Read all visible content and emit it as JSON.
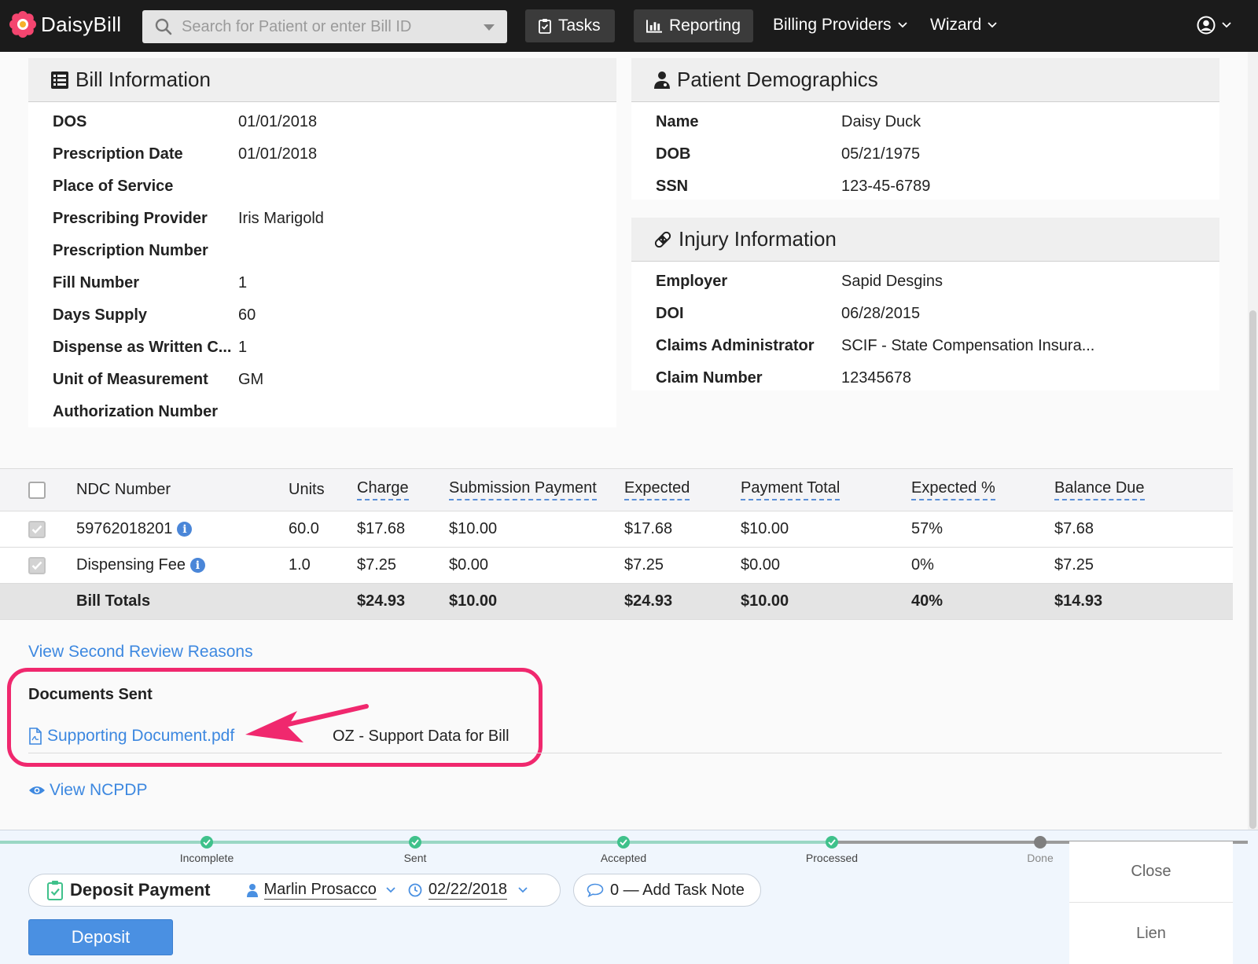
{
  "nav": {
    "brand": "DaisyBill",
    "search_placeholder": "Search for Patient or enter Bill ID",
    "tasks_label": "Tasks",
    "reporting_label": "Reporting",
    "billing_providers_label": "Billing Providers",
    "wizard_label": "Wizard"
  },
  "bill_info": {
    "title": "Bill Information",
    "rows": [
      {
        "label": "DOS",
        "value": "01/01/2018"
      },
      {
        "label": "Prescription Date",
        "value": "01/01/2018"
      },
      {
        "label": "Place of Service",
        "value": ""
      },
      {
        "label": "Prescribing Provider",
        "value": "Iris Marigold"
      },
      {
        "label": "Prescription Number",
        "value": ""
      },
      {
        "label": "Fill Number",
        "value": "1"
      },
      {
        "label": "Days Supply",
        "value": "60"
      },
      {
        "label": "Dispense as Written C...",
        "value": "1"
      },
      {
        "label": "Unit of Measurement",
        "value": "GM"
      },
      {
        "label": "Authorization Number",
        "value": ""
      }
    ]
  },
  "patient": {
    "title": "Patient Demographics",
    "rows": [
      {
        "label": "Name",
        "value": "Daisy Duck"
      },
      {
        "label": "DOB",
        "value": "05/21/1975"
      },
      {
        "label": "SSN",
        "value": "123-45-6789"
      }
    ]
  },
  "injury": {
    "title": "Injury Information",
    "rows": [
      {
        "label": "Employer",
        "value": "Sapid Desgins"
      },
      {
        "label": "DOI",
        "value": "06/28/2015"
      },
      {
        "label": "Claims Administrator",
        "value": "SCIF - State Compensation Insura..."
      },
      {
        "label": "Claim Number",
        "value": "12345678"
      }
    ]
  },
  "table": {
    "headers": {
      "ndc": "NDC Number",
      "units": "Units",
      "charge": "Charge",
      "submission": "Submission Payment",
      "expected": "Expected",
      "payment_total": "Payment Total",
      "expected_pct": "Expected %",
      "balance": "Balance Due"
    },
    "rows": [
      {
        "ndc": "59762018201",
        "units": "60.0",
        "charge": "$17.68",
        "submission": "$10.00",
        "expected": "$17.68",
        "payment_total": "$10.00",
        "expected_pct": "57%",
        "balance": "$7.68"
      },
      {
        "ndc": "Dispensing Fee",
        "units": "1.0",
        "charge": "$7.25",
        "submission": "$0.00",
        "expected": "$7.25",
        "payment_total": "$0.00",
        "expected_pct": "0%",
        "balance": "$7.25"
      }
    ],
    "totals": {
      "label": "Bill Totals",
      "charge": "$24.93",
      "submission": "$10.00",
      "expected": "$24.93",
      "payment_total": "$10.00",
      "expected_pct": "40%",
      "balance": "$14.93"
    }
  },
  "links": {
    "second_review": "View Second Review Reasons",
    "view_ncpdp": "View NCPDP"
  },
  "documents": {
    "title": "Documents Sent",
    "file_name": "Supporting Document.pdf",
    "file_type": "OZ - Support Data for Bill"
  },
  "workflow": {
    "steps": [
      "Incomplete",
      "Sent",
      "Accepted",
      "Processed",
      "Done"
    ]
  },
  "task": {
    "title": "Deposit Payment",
    "assignee": "Marlin Prosacco",
    "date": "02/22/2018",
    "note": "0 — Add Task Note",
    "deposit_label": "Deposit"
  },
  "side_actions": {
    "close": "Close",
    "lien": "Lien"
  },
  "colors": {
    "accent": "#4a90e2",
    "highlight": "#f0286e",
    "progress_done": "#3fc18b"
  }
}
